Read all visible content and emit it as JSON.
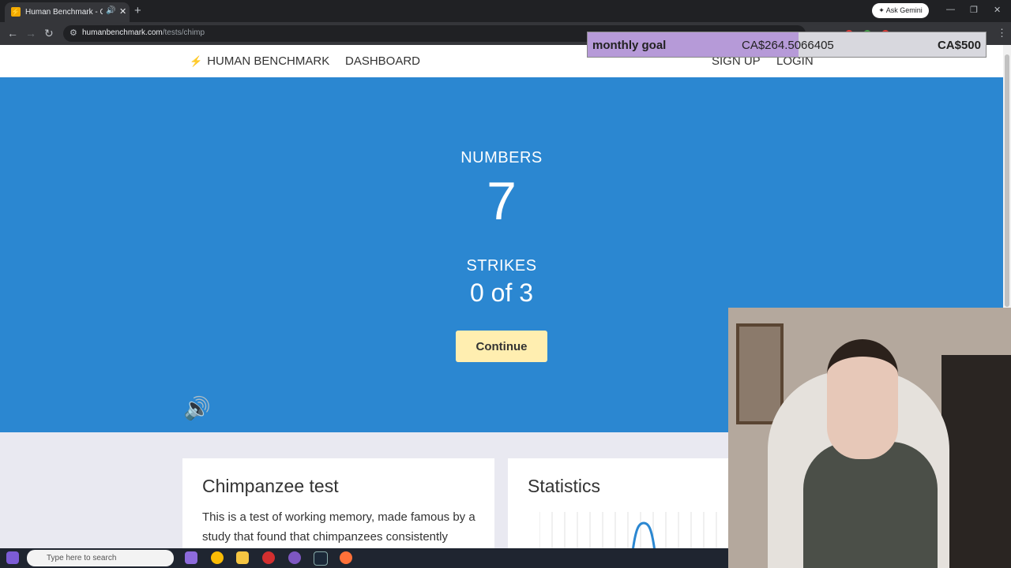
{
  "browser": {
    "tab_title": "Human Benchmark - Chimp",
    "tab_favicon": "⚡",
    "url_host": "humanbenchmark.com",
    "url_path": "/tests/chimp",
    "ask_gemini": "Ask Gemini"
  },
  "site": {
    "brand": "HUMAN BENCHMARK",
    "nav": {
      "dashboard": "DASHBOARD",
      "signup": "SIGN UP",
      "login": "LOGIN"
    }
  },
  "goal": {
    "label": "monthly goal",
    "current": "CA$264.5066405",
    "target": "CA$500",
    "progress_fraction": 0.529,
    "fill_color": "#b69ad8"
  },
  "hero": {
    "numbers_label": "NUMBERS",
    "numbers_value": "7",
    "strikes_label": "STRIKES",
    "strikes_value": "0 of 3",
    "continue_button": "Continue",
    "background": "#2b87d1",
    "button_color": "#ffeeb0"
  },
  "cards": {
    "test": {
      "title": "Chimpanzee test",
      "text": "This is a test of working memory, made famous by a study that found that chimpanzees consistently"
    },
    "stats": {
      "title": "Statistics"
    }
  },
  "taskbar": {
    "search_placeholder": "Type here to search"
  }
}
